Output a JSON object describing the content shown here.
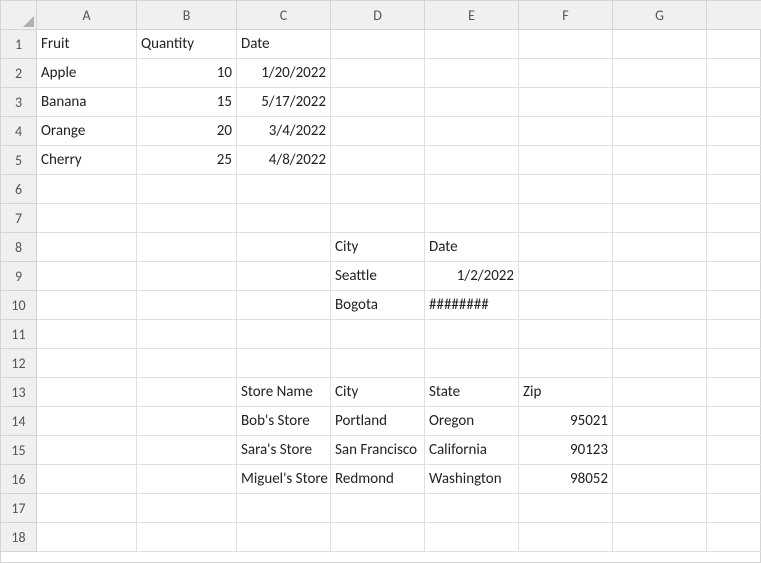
{
  "columns": [
    "A",
    "B",
    "C",
    "D",
    "E",
    "F",
    "G",
    ""
  ],
  "rows": 18,
  "cells": {
    "r1": {
      "A": {
        "v": "Fruit",
        "align": "left"
      },
      "B": {
        "v": "Quantity",
        "align": "left"
      },
      "C": {
        "v": "Date",
        "align": "left"
      }
    },
    "r2": {
      "A": {
        "v": "Apple",
        "align": "left"
      },
      "B": {
        "v": "10",
        "align": "right"
      },
      "C": {
        "v": "1/20/2022",
        "align": "right"
      }
    },
    "r3": {
      "A": {
        "v": "Banana",
        "align": "left"
      },
      "B": {
        "v": "15",
        "align": "right"
      },
      "C": {
        "v": "5/17/2022",
        "align": "right"
      }
    },
    "r4": {
      "A": {
        "v": "Orange",
        "align": "left"
      },
      "B": {
        "v": "20",
        "align": "right"
      },
      "C": {
        "v": "3/4/2022",
        "align": "right"
      }
    },
    "r5": {
      "A": {
        "v": "Cherry",
        "align": "left"
      },
      "B": {
        "v": "25",
        "align": "right"
      },
      "C": {
        "v": "4/8/2022",
        "align": "right"
      }
    },
    "r8": {
      "D": {
        "v": "City",
        "align": "left"
      },
      "E": {
        "v": "Date",
        "align": "left"
      }
    },
    "r9": {
      "D": {
        "v": "Seattle",
        "align": "left"
      },
      "E": {
        "v": "1/2/2022",
        "align": "right"
      }
    },
    "r10": {
      "D": {
        "v": "Bogota",
        "align": "left"
      },
      "E": {
        "v": "########",
        "align": "left"
      }
    },
    "r13": {
      "C": {
        "v": "Store Name",
        "align": "left"
      },
      "D": {
        "v": "City",
        "align": "left"
      },
      "E": {
        "v": "State",
        "align": "left"
      },
      "F": {
        "v": "Zip",
        "align": "left"
      }
    },
    "r14": {
      "C": {
        "v": "Bob's Store",
        "align": "left"
      },
      "D": {
        "v": "Portland",
        "align": "left"
      },
      "E": {
        "v": "Oregon",
        "align": "left"
      },
      "F": {
        "v": "95021",
        "align": "right"
      }
    },
    "r15": {
      "C": {
        "v": "Sara's Store",
        "align": "left"
      },
      "D": {
        "v": "San Francisco",
        "align": "left"
      },
      "E": {
        "v": "California",
        "align": "left"
      },
      "F": {
        "v": "90123",
        "align": "right"
      }
    },
    "r16": {
      "C": {
        "v": "Miguel's Store",
        "align": "left"
      },
      "D": {
        "v": "Redmond",
        "align": "left"
      },
      "E": {
        "v": "Washington",
        "align": "left"
      },
      "F": {
        "v": "98052",
        "align": "right"
      }
    }
  }
}
